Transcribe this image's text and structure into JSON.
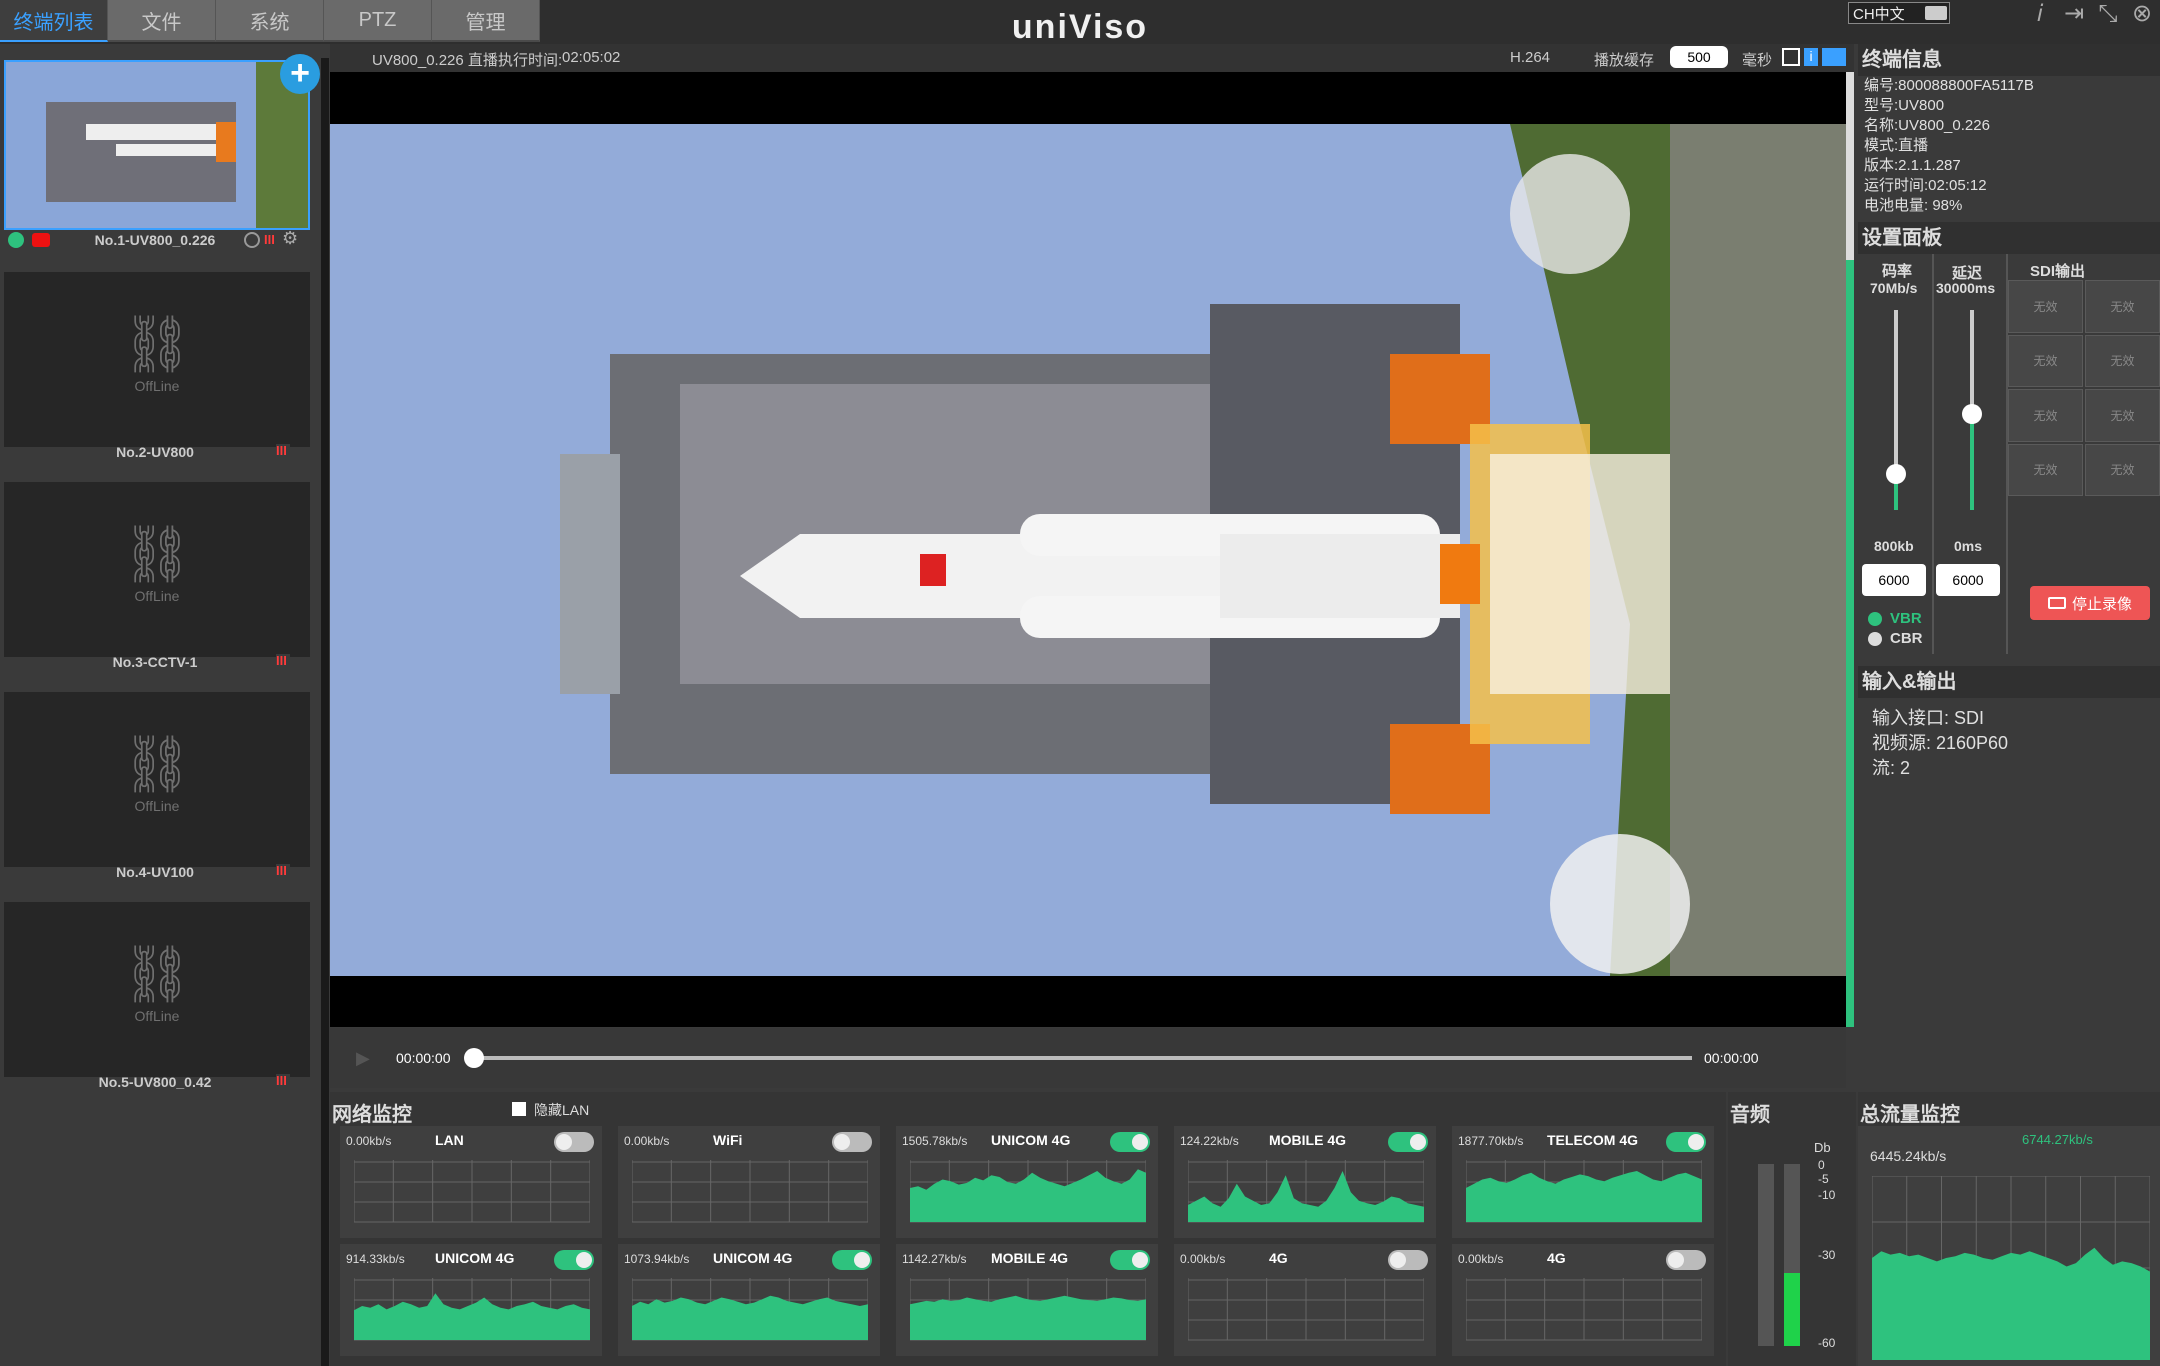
{
  "tabs": [
    "终端列表",
    "文件",
    "系统",
    "PTZ",
    "管理"
  ],
  "logo": "uniViso",
  "lang": "CH中文",
  "header": {
    "device_status": "UV800_0.226 直播",
    "exec_time_label": "执行时间:",
    "exec_time": "02:05:02",
    "codec": "H.264",
    "buffer_label": "播放缓存",
    "buffer_value": "500",
    "buffer_unit": "毫秒"
  },
  "devices": [
    {
      "name": "No.1-UV800_0.226",
      "online": true
    },
    {
      "name": "No.2-UV800",
      "status": "OffLine"
    },
    {
      "name": "No.3-CCTV-1",
      "status": "OffLine"
    },
    {
      "name": "No.4-UV100",
      "status": "OffLine"
    },
    {
      "name": "No.5-UV800_0.42",
      "status": "OffLine"
    }
  ],
  "playback": {
    "current": "00:00:00",
    "total": "00:00:00"
  },
  "terminal_info": {
    "title": "终端信息",
    "lines": [
      "编号:800088800FA5117B",
      "型号:UV800",
      "名称:UV800_0.226",
      "模式:直播",
      "版本:2.1.1.287",
      "运行时间:02:05:12",
      "电池电量: 98%"
    ]
  },
  "settings": {
    "title": "设置面板",
    "bitrate_label": "码率",
    "bitrate_max": "70Mb/s",
    "bitrate_min": "800kb",
    "bitrate_value": "6000",
    "delay_label": "延迟",
    "delay_max": "30000ms",
    "delay_min": "0ms",
    "delay_value": "6000",
    "sdi_label": "SDI输出",
    "sdi_cells": [
      "无效",
      "无效",
      "无效",
      "无效",
      "无效",
      "无效",
      "无效",
      "无效"
    ],
    "vbr": "VBR",
    "cbr": "CBR",
    "stop_rec": "停止录像"
  },
  "io": {
    "title": "输入&输出",
    "input": "输入接口: SDI",
    "source": "视频源: 2160P60",
    "streams": "流: 2"
  },
  "network": {
    "title": "网络监控",
    "hide_lan": "隐藏LAN",
    "cards": [
      {
        "rate": "0.00kb/s",
        "name": "LAN",
        "on": false,
        "data": []
      },
      {
        "rate": "0.00kb/s",
        "name": "WiFi",
        "on": false,
        "data": []
      },
      {
        "rate": "1505.78kb/s",
        "name": "UNICOM 4G",
        "on": true,
        "data": [
          40,
          42,
          38,
          45,
          50,
          48,
          44,
          46,
          52,
          49,
          55,
          53,
          47,
          45,
          50,
          58,
          52,
          48,
          45,
          42,
          46,
          50,
          55,
          60,
          52,
          48,
          45,
          50,
          62,
          58
        ]
      },
      {
        "rate": "124.22kb/s",
        "name": "MOBILE 4G",
        "on": true,
        "data": [
          20,
          25,
          30,
          22,
          18,
          28,
          45,
          30,
          25,
          20,
          22,
          35,
          55,
          28,
          22,
          20,
          18,
          25,
          40,
          60,
          35,
          25,
          22,
          20,
          24,
          30,
          28,
          22,
          20,
          18
        ]
      },
      {
        "rate": "1877.70kb/s",
        "name": "TELECOM 4G",
        "on": true,
        "data": [
          40,
          45,
          50,
          52,
          48,
          46,
          50,
          55,
          58,
          52,
          48,
          45,
          50,
          53,
          56,
          54,
          50,
          48,
          52,
          55,
          58,
          60,
          55,
          50,
          48,
          52,
          56,
          58,
          54,
          50
        ]
      },
      {
        "rate": "914.33kb/s",
        "name": "UNICOM 4G",
        "on": true,
        "data": [
          35,
          40,
          38,
          42,
          36,
          40,
          45,
          42,
          38,
          40,
          55,
          42,
          38,
          36,
          40,
          44,
          50,
          42,
          38,
          36,
          40,
          42,
          45,
          40,
          38,
          36,
          40,
          42,
          38,
          36
        ]
      },
      {
        "rate": "1073.94kb/s",
        "name": "UNICOM 4G",
        "on": true,
        "data": [
          40,
          45,
          42,
          48,
          44,
          46,
          50,
          48,
          44,
          42,
          46,
          50,
          48,
          45,
          42,
          44,
          48,
          52,
          50,
          46,
          44,
          42,
          45,
          48,
          50,
          46,
          44,
          42,
          40,
          42
        ]
      },
      {
        "rate": "1142.27kb/s",
        "name": "MOBILE 4G",
        "on": true,
        "data": [
          42,
          44,
          46,
          45,
          48,
          46,
          47,
          50,
          48,
          46,
          45,
          48,
          50,
          52,
          49,
          47,
          46,
          48,
          50,
          52,
          50,
          48,
          47,
          46,
          48,
          50,
          49,
          47,
          46,
          48
        ]
      },
      {
        "rate": "0.00kb/s",
        "name": "4G",
        "on": false,
        "data": []
      },
      {
        "rate": "0.00kb/s",
        "name": "4G",
        "on": false,
        "data": []
      }
    ]
  },
  "audio": {
    "title": "音频",
    "unit": "Db",
    "ticks": [
      "0",
      "-5",
      "-10",
      "-30",
      "-60"
    ],
    "level": 0.4
  },
  "total": {
    "title": "总流量监控",
    "peak": "6744.27kb/s",
    "current": "6445.24kb/s",
    "data": [
      60,
      64,
      62,
      63,
      61,
      62,
      60,
      58,
      60,
      61,
      63,
      62,
      60,
      59,
      61,
      63,
      62,
      64,
      62,
      60,
      58,
      55,
      57,
      62,
      66,
      60,
      56,
      58,
      57,
      55,
      52
    ]
  }
}
